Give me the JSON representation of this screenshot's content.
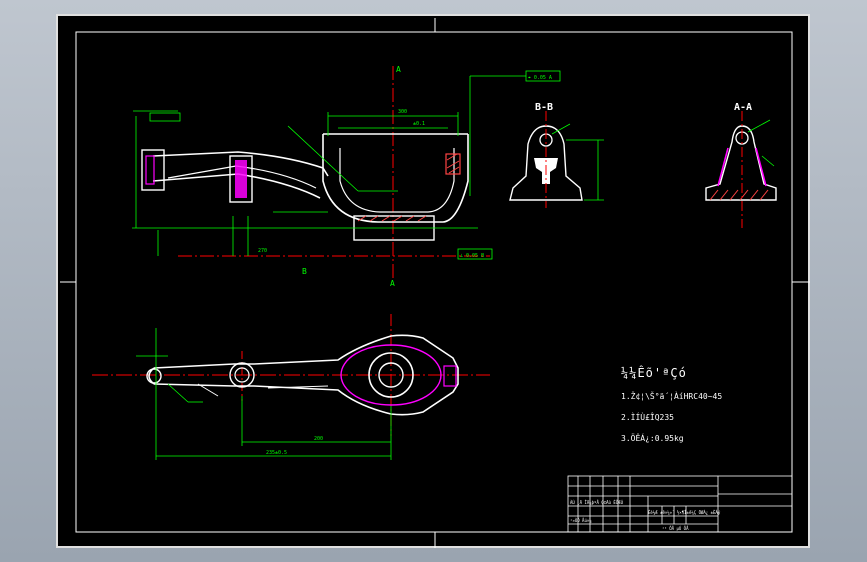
{
  "views": {
    "bb_label": "B-B",
    "aa_label": "A-A",
    "section_mark_a": "A",
    "section_mark_b": "B"
  },
  "notes": {
    "title": "¼¼Êõ'ªÇó",
    "items": [
      "1.Ž¢¦\\Š°ä´¦ÀíHRC40~45",
      "2.ÌÍÙ£ÎQ235",
      "3.ÖÊÁ¿:0.95kg"
    ]
  },
  "title_block": {
    "row1": "ÀÙ ¸Ä  ÎÄ¼þºÅ  Ç©Ãû ÈÕÆÚ",
    "row2": "Éè¼Æ  ±ê×¼»¯  ½×¶Î±ê¼Ç  ÖØÁ¿  ±ÈÀý",
    "row3": "¹¤ÒÕ  Åú×¼",
    "row4": "¹²   ÕÅ  µÚ  ÕÅ"
  },
  "colors": {
    "sheet": "#000000",
    "frame": "#ffffff",
    "dimension": "#00ff00",
    "centerline": "#ff0000",
    "hidden": "#ff00ff",
    "hatch": "#ff4040",
    "part": "#ffffff"
  }
}
